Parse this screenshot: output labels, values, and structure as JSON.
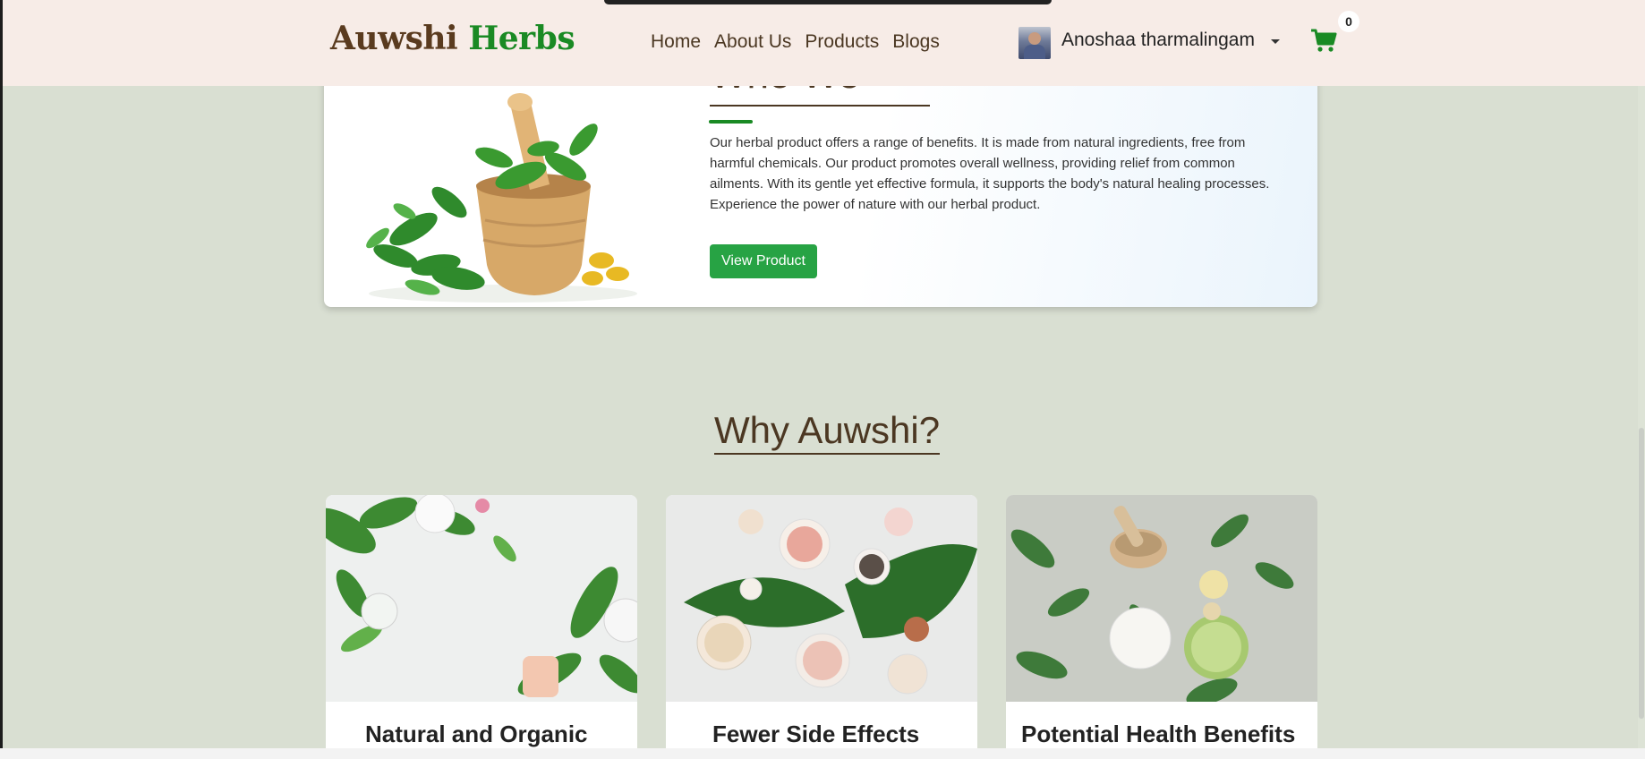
{
  "header": {
    "logo_part1": "Auwshi",
    "logo_part2": "Herbs",
    "nav": [
      "Home",
      "About Us",
      "Products",
      "Blogs"
    ],
    "username": "Anoshaa tharmalingam",
    "cart_count": "0"
  },
  "who": {
    "title": "Who We Are?",
    "text": "Our herbal product offers a range of benefits. It is made from natural ingredients, free from harmful chemicals. Our product promotes overall wellness, providing relief from common ailments. With its gentle yet effective formula, it supports the body's natural healing processes. Experience the power of nature with our herbal product.",
    "button": "View Product"
  },
  "why": {
    "title": "Why Auwshi?",
    "cards": [
      {
        "label": "Natural and Organic"
      },
      {
        "label": "Fewer Side Effects"
      },
      {
        "label": "Potential Health Benefits"
      }
    ]
  },
  "colors": {
    "brand_brown": "#5a3b1f",
    "brand_green": "#1a8a24",
    "button_green": "#27a344",
    "page_bg": "#d9dfd2",
    "header_bg": "#f7ece7"
  }
}
